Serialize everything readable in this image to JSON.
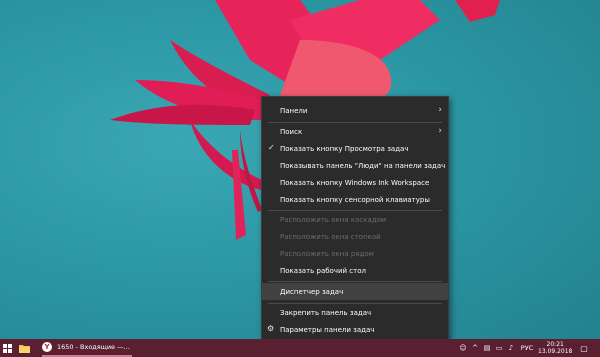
{
  "menu": {
    "items": [
      {
        "label": "Панели",
        "submenu": true
      },
      {
        "label": "Поиск",
        "submenu": true
      },
      {
        "label": "Показать кнопку Просмотра задач",
        "checked": true
      },
      {
        "label": "Показывать панель \"Люди\" на панели задач"
      },
      {
        "label": "Показать кнопку Windows Ink Workspace"
      },
      {
        "label": "Показать кнопку сенсорной клавиатуры"
      },
      {
        "label": "Расположить окна каскадом",
        "disabled": true
      },
      {
        "label": "Расположить окна стопкой",
        "disabled": true
      },
      {
        "label": "Расположить окна рядом",
        "disabled": true
      },
      {
        "label": "Показать рабочий стол"
      },
      {
        "label": "Диспетчер задач",
        "highlighted": true
      },
      {
        "label": "Закрепить панель задач"
      },
      {
        "label": "Параметры панели задач",
        "icon": "gear-icon"
      }
    ]
  },
  "taskbar": {
    "app_title": "1650 - Входящие —...",
    "app_icon_letter": "Y",
    "language": "РУС",
    "time": "20:21",
    "date": "13.09.2018",
    "color": "#5a1f31"
  },
  "colors": {
    "menu_bg": "#2b2b2b",
    "menu_highlight": "#414141",
    "disabled_text": "#6d6d6d"
  }
}
